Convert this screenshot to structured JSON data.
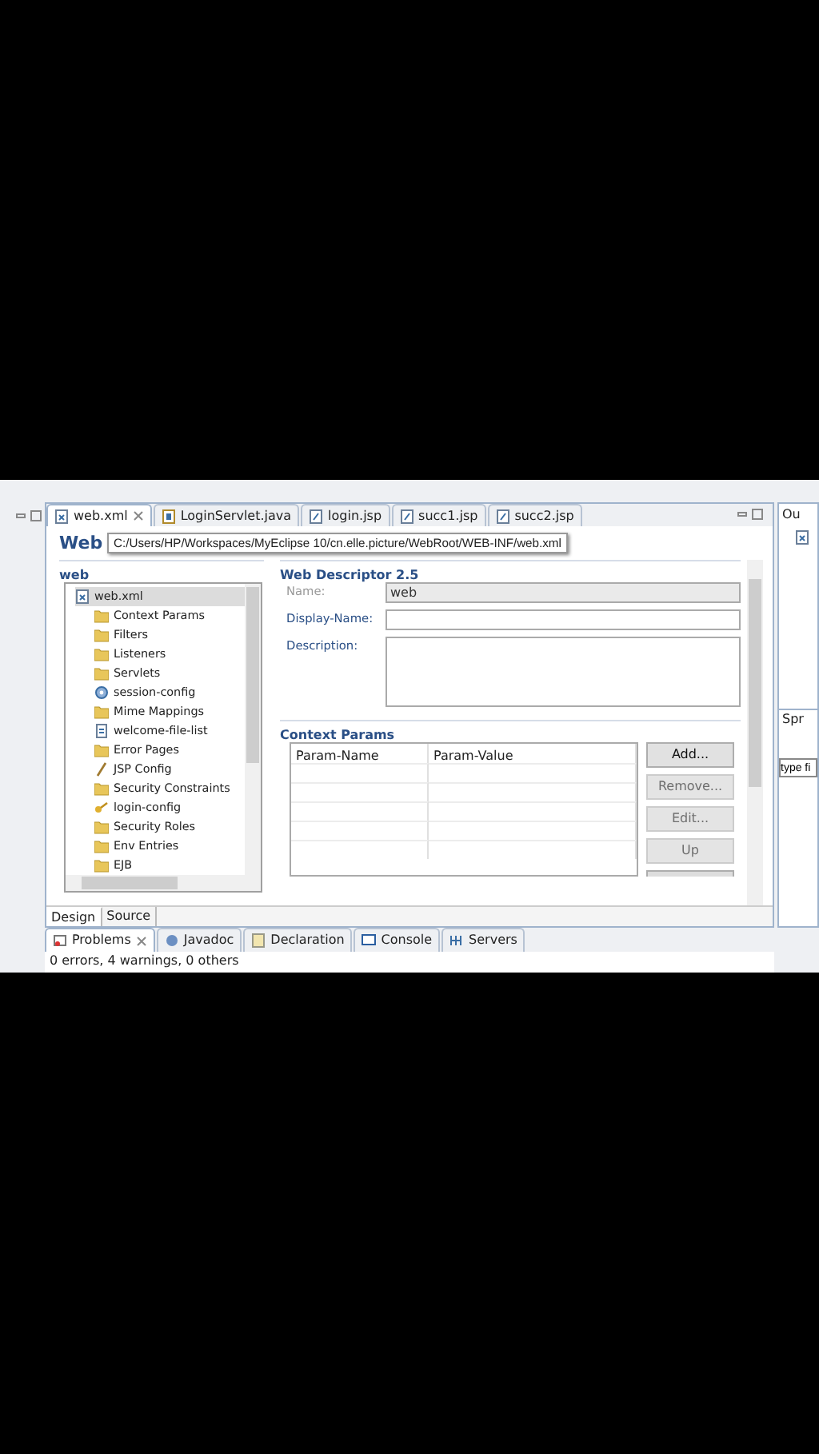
{
  "editor": {
    "tabs": [
      {
        "label": "web.xml",
        "kind": "xml",
        "selected": true,
        "closable": true
      },
      {
        "label": "LoginServlet.java",
        "kind": "java",
        "selected": false,
        "closable": false
      },
      {
        "label": "login.jsp",
        "kind": "jsp",
        "selected": false,
        "closable": false
      },
      {
        "label": "succ1.jsp",
        "kind": "jsp",
        "selected": false,
        "closable": false
      },
      {
        "label": "succ2.jsp",
        "kind": "jsp",
        "selected": false,
        "closable": false
      }
    ],
    "title": "Web",
    "tooltip": "C:/Users/HP/Workspaces/MyEclipse 10/cn.elle.picture/WebRoot/WEB-INF/web.xml",
    "tree_section": {
      "title": "web",
      "tree": [
        {
          "label": "web.xml",
          "kind": "xml",
          "selected": true,
          "children": [
            {
              "label": "Context Params",
              "kind": "folder",
              "selected": false
            },
            {
              "label": "Filters",
              "kind": "folder",
              "selected": false
            },
            {
              "label": "Listeners",
              "kind": "folder",
              "selected": false
            },
            {
              "label": "Servlets",
              "kind": "folder",
              "selected": false
            },
            {
              "label": "session-config",
              "kind": "gear",
              "selected": false
            },
            {
              "label": "Mime Mappings",
              "kind": "folder",
              "selected": false
            },
            {
              "label": "welcome-file-list",
              "kind": "page",
              "selected": false
            },
            {
              "label": "Error Pages",
              "kind": "folder",
              "selected": false
            },
            {
              "label": "JSP Config",
              "kind": "pencil",
              "selected": false
            },
            {
              "label": "Security Constraints",
              "kind": "folder",
              "selected": false
            },
            {
              "label": "login-config",
              "kind": "key",
              "selected": false
            },
            {
              "label": "Security Roles",
              "kind": "folder",
              "selected": false
            },
            {
              "label": "Env Entries",
              "kind": "folder",
              "selected": false
            },
            {
              "label": "EJB",
              "kind": "folder",
              "selected": false
            }
          ]
        }
      ]
    },
    "descriptor": {
      "title": "Web Descriptor 2.5",
      "fields": [
        {
          "label": "Name:",
          "value": "web",
          "kind": "input",
          "disabled": true
        },
        {
          "label": "Display-Name:",
          "kind": "input",
          "disabled": false
        },
        {
          "label": "Description:",
          "kind": "textarea",
          "disabled": false
        }
      ]
    },
    "context_params": {
      "title": "Context Params",
      "columns": [
        "Param-Name",
        "Param-Value"
      ],
      "buttons": [
        {
          "label": "Add...",
          "disabled": false
        },
        {
          "label": "Remove...",
          "disabled": true
        },
        {
          "label": "Edit...",
          "disabled": true
        },
        {
          "label": "Up",
          "disabled": true
        }
      ]
    },
    "page_tabs": [
      {
        "label": "Design",
        "selected": true
      },
      {
        "label": "Source",
        "selected": false
      }
    ]
  },
  "bottom_panel": {
    "tabs": [
      {
        "label": "Problems",
        "kind": "problems",
        "selected": true,
        "closable": true
      },
      {
        "label": "Javadoc",
        "kind": "javadoc",
        "selected": false,
        "closable": false
      },
      {
        "label": "Declaration",
        "kind": "declaration",
        "selected": false,
        "closable": false
      },
      {
        "label": "Console",
        "kind": "console",
        "selected": false,
        "closable": false
      },
      {
        "label": "Servers",
        "kind": "servers",
        "selected": false,
        "closable": false
      }
    ],
    "status": "0 errors, 4 warnings, 0 others"
  },
  "right_panel": {
    "outline_tab": "Ou",
    "spring_tab": "Spr",
    "filter": {
      "value": "type fi"
    }
  }
}
